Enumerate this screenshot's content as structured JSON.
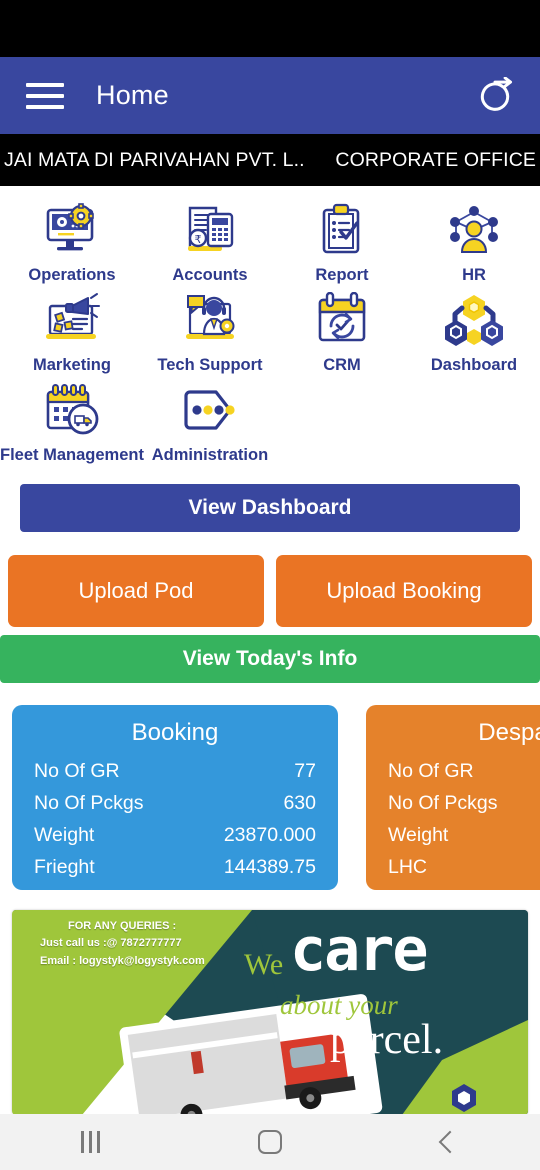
{
  "appbar": {
    "title": "Home",
    "menu_icon": "hamburger-menu-icon",
    "logout_icon": "logout-icon"
  },
  "company_strip": {
    "name": "JAI MATA DI PARIVAHAN PVT. L..",
    "office": "CORPORATE OFFICE"
  },
  "grid": {
    "items": [
      {
        "label": "Operations",
        "icon": "monitor-gear-icon"
      },
      {
        "label": "Accounts",
        "icon": "invoice-calculator-icon"
      },
      {
        "label": "Report",
        "icon": "clipboard-check-icon"
      },
      {
        "label": "HR",
        "icon": "person-network-icon"
      },
      {
        "label": "Marketing",
        "icon": "megaphone-laptop-icon"
      },
      {
        "label": "Tech Support",
        "icon": "headset-agent-icon"
      },
      {
        "label": "CRM",
        "icon": "calendar-refresh-icon"
      },
      {
        "label": "Dashboard",
        "icon": "hexagon-nodes-icon"
      },
      {
        "label": "Fleet Management",
        "icon": "calendar-truck-icon"
      },
      {
        "label": "Administration",
        "icon": "tag-dots-icon"
      }
    ]
  },
  "actions": {
    "view_dashboard": "View Dashboard",
    "upload_pod": "Upload Pod",
    "upload_booking": "Upload Booking",
    "view_today_info": "View Today's Info"
  },
  "cards": [
    {
      "title": "Booking",
      "color": "#3498db",
      "rows": [
        {
          "label": "No Of GR",
          "value": "77"
        },
        {
          "label": "No Of Pckgs",
          "value": "630"
        },
        {
          "label": "Weight",
          "value": "23870.000"
        },
        {
          "label": "Frieght",
          "value": "144389.75"
        }
      ]
    },
    {
      "title": "Despatch",
      "color": "#e5822b",
      "rows": [
        {
          "label": "No Of GR",
          "value": ""
        },
        {
          "label": "No Of Pckgs",
          "value": ""
        },
        {
          "label": "Weight",
          "value": ""
        },
        {
          "label": "LHC",
          "value": ""
        }
      ]
    }
  ],
  "promo": {
    "queries_title": "FOR ANY QUERIES :",
    "phone_line": "Just call us :@ 7872777777",
    "email_line": "Email : logystyk@logystyk.com",
    "we": "We",
    "care": "care",
    "about_your": "about your",
    "parcel": "parcel."
  },
  "navbar": {
    "recent_label": "recent-apps",
    "home_label": "home",
    "back_label": "back"
  },
  "colors": {
    "header_blue": "#39479f",
    "orange": "#ea7424",
    "green": "#36b35e",
    "card_blue": "#3498db",
    "card_orange": "#e5822b",
    "label_navy": "#2e3a8c",
    "icon_yellow": "#f6d322"
  }
}
